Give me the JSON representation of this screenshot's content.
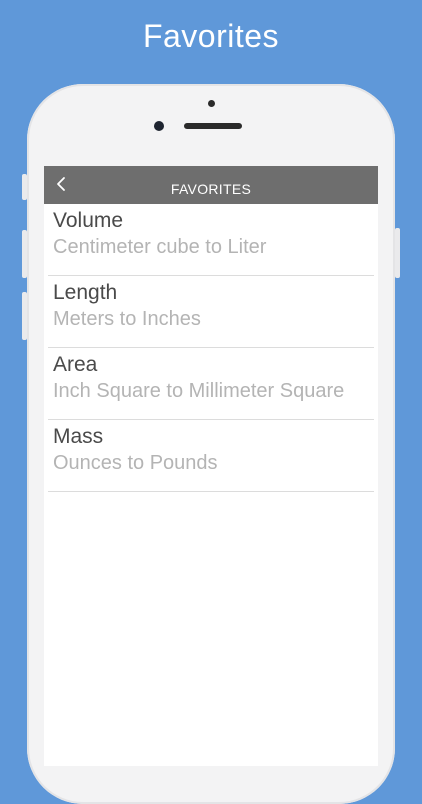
{
  "promo": {
    "title": "Favorites"
  },
  "navbar": {
    "back_icon": "chevron-left-icon",
    "title": "FAVORITES"
  },
  "favorites": [
    {
      "title": "Volume",
      "subtitle": "Centimeter cube to Liter"
    },
    {
      "title": "Length",
      "subtitle": "Meters to Inches"
    },
    {
      "title": "Area",
      "subtitle": "Inch Square to Millimeter Square"
    },
    {
      "title": "Mass",
      "subtitle": "Ounces to Pounds"
    }
  ],
  "colors": {
    "background": "#5f98d9",
    "navbar": "#6e6e6e",
    "row_title": "#4a4a4a",
    "row_subtitle": "#b4b4b4"
  }
}
